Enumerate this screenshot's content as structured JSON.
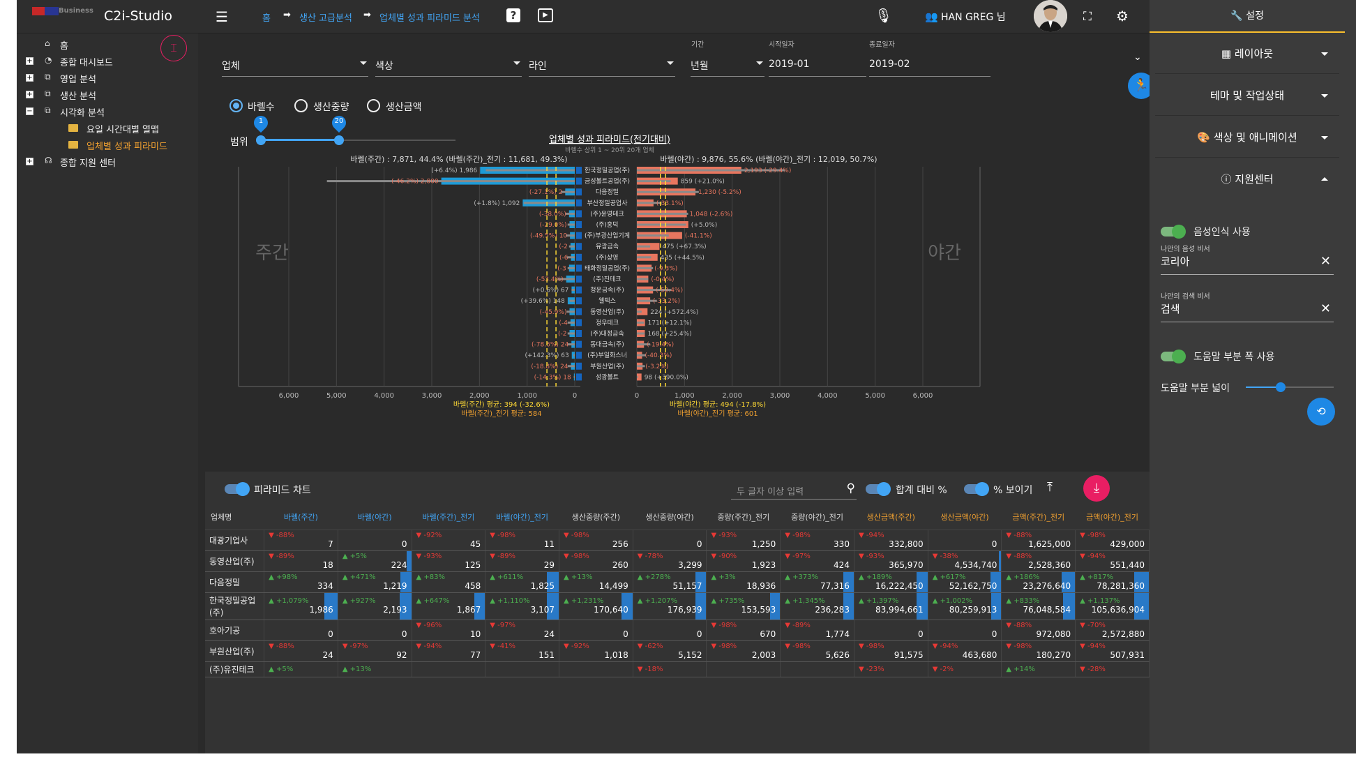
{
  "app": {
    "logo_text": "Business",
    "title": "C2i-Studio"
  },
  "breadcrumb": [
    "홈",
    "생산 고급분석",
    "업체별 성과 피라미드 분석"
  ],
  "user": {
    "name": "HAN GREG 님"
  },
  "sidebar": {
    "items": [
      {
        "label": "홈",
        "icon": "home-icon",
        "expand": ""
      },
      {
        "label": "종합 대시보드",
        "icon": "dashboard-icon",
        "expand": "+"
      },
      {
        "label": "영업 분석",
        "icon": "chart-icon",
        "expand": "+"
      },
      {
        "label": "생산 분석",
        "icon": "chart-icon",
        "expand": "+"
      },
      {
        "label": "시각화 분석",
        "icon": "chart-icon",
        "expand": "−"
      },
      {
        "label": "요일 시간대별 열맵",
        "icon": "folder-icon",
        "expand": ""
      },
      {
        "label": "업체별 성과 피라미드",
        "icon": "folder-icon",
        "expand": ""
      },
      {
        "label": "종합 지원 센터",
        "icon": "support-icon",
        "expand": "+"
      }
    ]
  },
  "filters": {
    "company": "업체",
    "color": "색상",
    "line": "라인",
    "period_label": "기간",
    "period": "년월",
    "start_label": "시작일자",
    "start": "2019-01",
    "end_label": "종료일자",
    "end": "2019-02"
  },
  "radios": {
    "options": [
      "바렐수",
      "생산중량",
      "생산금액"
    ],
    "selected": 0
  },
  "range": {
    "label": "범위",
    "min_badge": "1",
    "max_badge": "20"
  },
  "chart_data": {
    "type": "bar",
    "title": "업체별 성과 피라미드(전기대비)",
    "subtitle": "바렐수 상위 1 ~ 20위 20개 업체",
    "left_header": "바렐(주간) : 7,871, 44.4% (바렐(주간)_전기 : 11,681, 49.3%)",
    "right_header": "바렐(야간) : 9,876, 55.6% (바렐(야간)_전기 : 12,019, 50.7%)",
    "left_side_label": "주간",
    "right_side_label": "야간",
    "categories": [
      "한국정밀공업(주)",
      "금성볼트공업(주)",
      "다음정밀",
      "부산정밀공업사",
      "(주)윤영테크",
      "(주)홍덕",
      "(주)부광산업기계",
      "유광금속",
      "(주)상영",
      "태화정밀공업(주)",
      "(주)진테크",
      "청운금속(주)",
      "웰텍스",
      "동영산업(주)",
      "정우테크",
      "(주)대정금속",
      "동대금속(주)",
      "(주)부일화스너",
      "부원산업(주)",
      "성광볼트"
    ],
    "series": [
      {
        "name": "바렐(주간)",
        "values": [
          1986,
          2800,
          200,
          1092,
          120,
          110,
          100,
          90,
          80,
          120,
          180,
          67,
          148,
          110,
          90,
          110,
          70,
          63,
          80,
          18
        ]
      },
      {
        "name": "바렐(주간)_전기",
        "values": [
          1867,
          5200,
          290,
          1073,
          190,
          150,
          190,
          120,
          170,
          150,
          360,
          67,
          110,
          170,
          150,
          150,
          150,
          27,
          150,
          20
        ]
      },
      {
        "name": "바렐(야간)",
        "values": [
          2193,
          859,
          1230,
          350,
          1048,
          1080,
          950,
          475,
          435,
          310,
          240,
          340,
          280,
          224,
          171,
          168,
          150,
          110,
          120,
          98
        ]
      },
      {
        "name": "바렐(야간)_전기",
        "values": [
          3107,
          710,
          1300,
          520,
          1076,
          1030,
          670,
          280,
          300,
          340,
          240,
          720,
          420,
          100,
          150,
          160,
          280,
          190,
          170,
          20
        ]
      }
    ],
    "left_labels": [
      "(+6.4%) 1,986",
      "(-46.2%) 2,800",
      "(-27.1%) 2",
      "(+1.8%) 1,092",
      "(-38.0%)",
      "(-29.0%)",
      "(-49.5%) 10",
      "(-2",
      "(-6",
      "(-3",
      "(-53.4%)",
      "(+0.6%) 67",
      "(+39.6%) 148",
      "(-45.9%)",
      "(-4",
      "(-2",
      "(-78.6%) 24",
      "(+142.3%) 63",
      "(-18.8%) 24",
      "(-14.3%) 18"
    ],
    "right_labels": [
      "2,193 (-29.4%)",
      "859 (+21.0%)",
      "1,230 (-5.2%)",
      "(-33.1%)",
      "1,048 (-2.6%)",
      "(+5.0%)",
      "(-41.1%)",
      "475 (+67.3%)",
      "435 (+44.5%)",
      "(-9.3%)",
      "(-0.4%)",
      "(-52.4%)",
      "(-33.2%)",
      "224 (+572.4%)",
      "171 (+12.1%)",
      "168 (+25.4%)",
      "(-19.4%)",
      "(-40.3%)",
      "(-3.2%)",
      "98 (+390.0%)"
    ],
    "left_ticks": [
      "6,000",
      "5,000",
      "4,000",
      "3,000",
      "2,000",
      "1,000",
      "0"
    ],
    "right_ticks": [
      "0",
      "1,000",
      "2,000",
      "3,000",
      "4,000",
      "5,000",
      "6,000"
    ],
    "xlim": [
      0,
      6000
    ],
    "avg_left": "바렐(주간) 평균: 394 (-32.6%)",
    "avg_left_prev": "바렐(주간)_전기 평균: 584",
    "avg_right": "바렐(야간) 평균: 494 (-17.8%)",
    "avg_right_prev": "바렐(야간)_전기 평균: 601",
    "avg_values": {
      "left": 394,
      "left_prev": 584,
      "right": 494,
      "right_prev": 601
    },
    "colors": {
      "left": "#1e9bd7",
      "right": "#e8765f",
      "prev": "#8a8a8a",
      "avg": "#fdd835"
    }
  },
  "table_toolbar": {
    "pyramid_label": "피라미드 차트",
    "search_placeholder": "두 글자 이상 입력",
    "total_pct_label": "합계 대비 %",
    "show_pct_label": "% 보이기"
  },
  "table": {
    "headers": [
      {
        "t": "업체명",
        "c": ""
      },
      {
        "t": "바렐(주간)",
        "c": "blue"
      },
      {
        "t": "바렐(야간)",
        "c": "blue"
      },
      {
        "t": "바렐(주간)_전기",
        "c": "blue"
      },
      {
        "t": "바렐(야간)_전기",
        "c": "blue"
      },
      {
        "t": "생산중량(주간)",
        "c": ""
      },
      {
        "t": "생산중량(야간)",
        "c": ""
      },
      {
        "t": "중량(주간)_전기",
        "c": ""
      },
      {
        "t": "중량(야간)_전기",
        "c": ""
      },
      {
        "t": "생산금액(주간)",
        "c": "orange"
      },
      {
        "t": "생산금액(야간)",
        "c": "orange"
      },
      {
        "t": "금액(주간)_전기",
        "c": "orange"
      },
      {
        "t": "금액(야간)_전기",
        "c": "orange"
      }
    ],
    "rows": [
      {
        "name": "대광기업사",
        "cells": [
          [
            "dn",
            "-88%",
            "7",
            0
          ],
          [
            "",
            "",
            "0",
            0
          ],
          [
            "dn",
            "-92%",
            "45",
            0
          ],
          [
            "dn",
            "-98%",
            "11",
            0
          ],
          [
            "dn",
            "-98%",
            "256",
            0
          ],
          [
            "",
            "",
            "0",
            0
          ],
          [
            "dn",
            "-93%",
            "1,250",
            0
          ],
          [
            "dn",
            "-98%",
            "330",
            0
          ],
          [
            "dn",
            "-94%",
            "332,800",
            0
          ],
          [
            "",
            "",
            "0",
            0
          ],
          [
            "dn",
            "-88%",
            "1,625,000",
            0
          ],
          [
            "dn",
            "-98%",
            "429,000",
            0
          ]
        ]
      },
      {
        "name": "동영산업(주)",
        "cells": [
          [
            "dn",
            "-89%",
            "18",
            0
          ],
          [
            "up",
            "+5%",
            "224",
            0.06
          ],
          [
            "dn",
            "-93%",
            "125",
            0
          ],
          [
            "dn",
            "-89%",
            "29",
            0
          ],
          [
            "dn",
            "-98%",
            "260",
            0
          ],
          [
            "dn",
            "-78%",
            "3,299",
            0
          ],
          [
            "dn",
            "-90%",
            "1,923",
            0
          ],
          [
            "dn",
            "-97%",
            "424",
            0
          ],
          [
            "dn",
            "-93%",
            "365,970",
            0
          ],
          [
            "dn",
            "-38%",
            "4,534,740",
            0.03
          ],
          [
            "dn",
            "-88%",
            "2,528,360",
            0
          ],
          [
            "dn",
            "-94%",
            "551,440",
            0
          ]
        ]
      },
      {
        "name": "다음정밀",
        "cells": [
          [
            "up",
            "+98%",
            "334",
            0
          ],
          [
            "up",
            "+471%",
            "1,219",
            0.15
          ],
          [
            "up",
            "+83%",
            "458",
            0
          ],
          [
            "up",
            "+611%",
            "1,825",
            0.16
          ],
          [
            "up",
            "+13%",
            "14,499",
            0
          ],
          [
            "up",
            "+278%",
            "51,157",
            0.15
          ],
          [
            "up",
            "+3%",
            "18,936",
            0
          ],
          [
            "up",
            "+373%",
            "77,316",
            0.14
          ],
          [
            "up",
            "+189%",
            "16,222,450",
            0.15
          ],
          [
            "up",
            "+617%",
            "52,162,750",
            0.15
          ],
          [
            "up",
            "+186%",
            "23,276,640",
            0.18
          ],
          [
            "up",
            "+817%",
            "78,281,360",
            0.2
          ]
        ]
      },
      {
        "name": "한국정밀공업(주)",
        "cells": [
          [
            "up",
            "+1,079%",
            "1,986",
            0.18
          ],
          [
            "up",
            "+927%",
            "2,193",
            0.16
          ],
          [
            "up",
            "+647%",
            "1,867",
            0.15
          ],
          [
            "up",
            "+1,110%",
            "3,107",
            0.16
          ],
          [
            "up",
            "+1,231%",
            "170,640",
            0.15
          ],
          [
            "up",
            "+1,207%",
            "176,939",
            0.15
          ],
          [
            "up",
            "+735%",
            "153,593",
            0.14
          ],
          [
            "up",
            "+1,345%",
            "236,283",
            0.14
          ],
          [
            "up",
            "+1,397%",
            "83,994,661",
            0.15
          ],
          [
            "up",
            "+1,002%",
            "80,259,913",
            0.14
          ],
          [
            "up",
            "+833%",
            "76,048,584",
            0.16
          ],
          [
            "up",
            "+1,137%",
            "105,636,904",
            0.2
          ]
        ]
      },
      {
        "name": "호아기공",
        "cells": [
          [
            "",
            "",
            "0",
            0
          ],
          [
            "",
            "",
            "0",
            0
          ],
          [
            "dn",
            "-96%",
            "10",
            0
          ],
          [
            "dn",
            "-97%",
            "24",
            0
          ],
          [
            "",
            "",
            "0",
            0
          ],
          [
            "",
            "",
            "0",
            0
          ],
          [
            "dn",
            "-98%",
            "670",
            0
          ],
          [
            "dn",
            "-89%",
            "1,774",
            0
          ],
          [
            "",
            "",
            "0",
            0
          ],
          [
            "",
            "",
            "0",
            0
          ],
          [
            "dn",
            "-88%",
            "972,080",
            0
          ],
          [
            "dn",
            "-70%",
            "2,572,880",
            0
          ]
        ]
      },
      {
        "name": "부원산업(주)",
        "cells": [
          [
            "dn",
            "-88%",
            "24",
            0
          ],
          [
            "dn",
            "-97%",
            "92",
            0
          ],
          [
            "dn",
            "-94%",
            "77",
            0
          ],
          [
            "dn",
            "-41%",
            "151",
            0
          ],
          [
            "dn",
            "-92%",
            "1,018",
            0
          ],
          [
            "dn",
            "-62%",
            "5,152",
            0
          ],
          [
            "dn",
            "-98%",
            "2,003",
            0
          ],
          [
            "dn",
            "-98%",
            "5,626",
            0
          ],
          [
            "dn",
            "-98%",
            "91,575",
            0
          ],
          [
            "dn",
            "-94%",
            "463,680",
            0
          ],
          [
            "dn",
            "-98%",
            "180,270",
            0
          ],
          [
            "dn",
            "-94%",
            "507,931",
            0
          ]
        ]
      },
      {
        "name": "(주)유진테크",
        "cells": [
          [
            "up",
            "+5%",
            "",
            0
          ],
          [
            "up",
            "+13%",
            "",
            0
          ],
          [
            "",
            "",
            "",
            0
          ],
          [
            "",
            "",
            "",
            0
          ],
          [
            "",
            "",
            "",
            0
          ],
          [
            "dn",
            "-18%",
            "",
            0
          ],
          [
            "",
            "",
            "",
            0
          ],
          [
            "",
            "",
            "",
            0
          ],
          [
            "dn",
            "-23%",
            "",
            0
          ],
          [
            "dn",
            "-2%",
            "",
            0
          ],
          [
            "up",
            "+14%",
            "",
            0
          ],
          [
            "dn",
            "-28%",
            "",
            0
          ]
        ]
      }
    ]
  },
  "settings": {
    "header": "설정",
    "sections": [
      {
        "label": "레이아웃",
        "open": false
      },
      {
        "label": "테마 및 작업상태",
        "open": false
      },
      {
        "label": "색상 및 애니메이션",
        "open": false
      },
      {
        "label": "지원센터",
        "open": true
      }
    ],
    "voice_toggle": "음성인식 사용",
    "voice_assistant_label": "나만의 음성 비서",
    "voice_assistant_value": "코리아",
    "search_assistant_label": "나만의 검색 비서",
    "search_assistant_value": "검색",
    "help_width_toggle": "도움말 부분 폭 사용",
    "help_width_label": "도움말 부분 넓이",
    "help_width_level": 0.4
  }
}
